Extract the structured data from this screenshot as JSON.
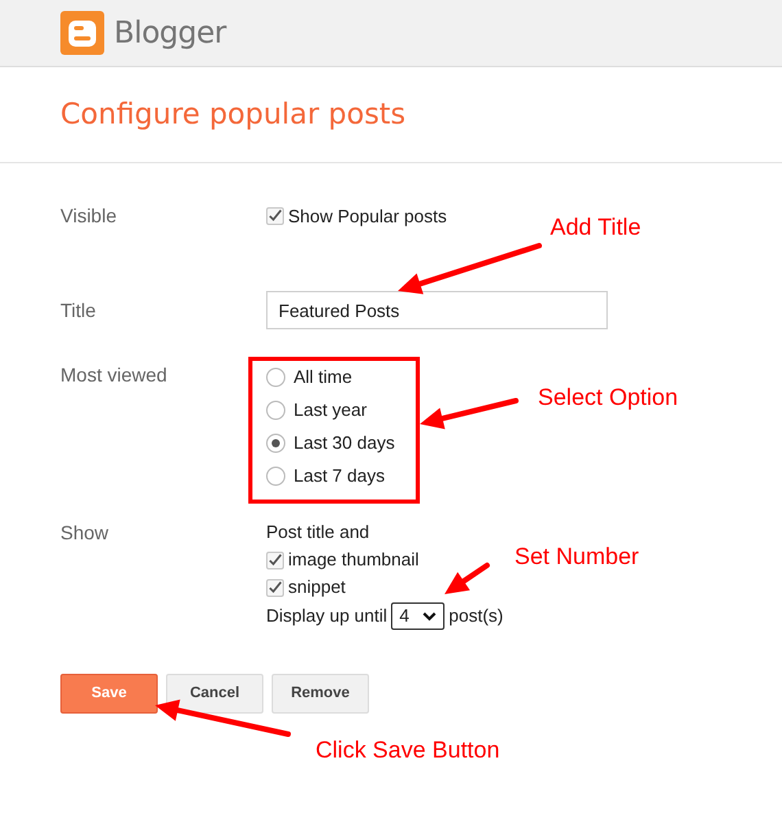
{
  "header": {
    "logo_text": "Blogger"
  },
  "page_title": "Configure popular posts",
  "visible": {
    "label": "Visible",
    "option": {
      "label": "Show Popular posts",
      "checked": true
    }
  },
  "title": {
    "label": "Title",
    "value": "Featured Posts"
  },
  "most_viewed": {
    "label": "Most viewed",
    "options": [
      {
        "label": "All time",
        "selected": false
      },
      {
        "label": "Last year",
        "selected": false
      },
      {
        "label": "Last 30 days",
        "selected": true
      },
      {
        "label": "Last 7 days",
        "selected": false
      }
    ]
  },
  "show": {
    "label": "Show",
    "intro": "Post title and",
    "options": [
      {
        "label": "image thumbnail",
        "checked": true
      },
      {
        "label": "snippet",
        "checked": true
      }
    ],
    "count_prefix": "Display up until",
    "count": "4",
    "count_suffix": "post(s)"
  },
  "buttons": [
    {
      "label": "Save",
      "kind": "primary"
    },
    {
      "label": "Cancel",
      "kind": "secondary"
    },
    {
      "label": "Remove",
      "kind": "secondary"
    }
  ],
  "annotations": [
    {
      "text": "Add Title"
    },
    {
      "text": "Select Option"
    },
    {
      "text": "Set Number"
    },
    {
      "text": "Click Save Button"
    }
  ]
}
